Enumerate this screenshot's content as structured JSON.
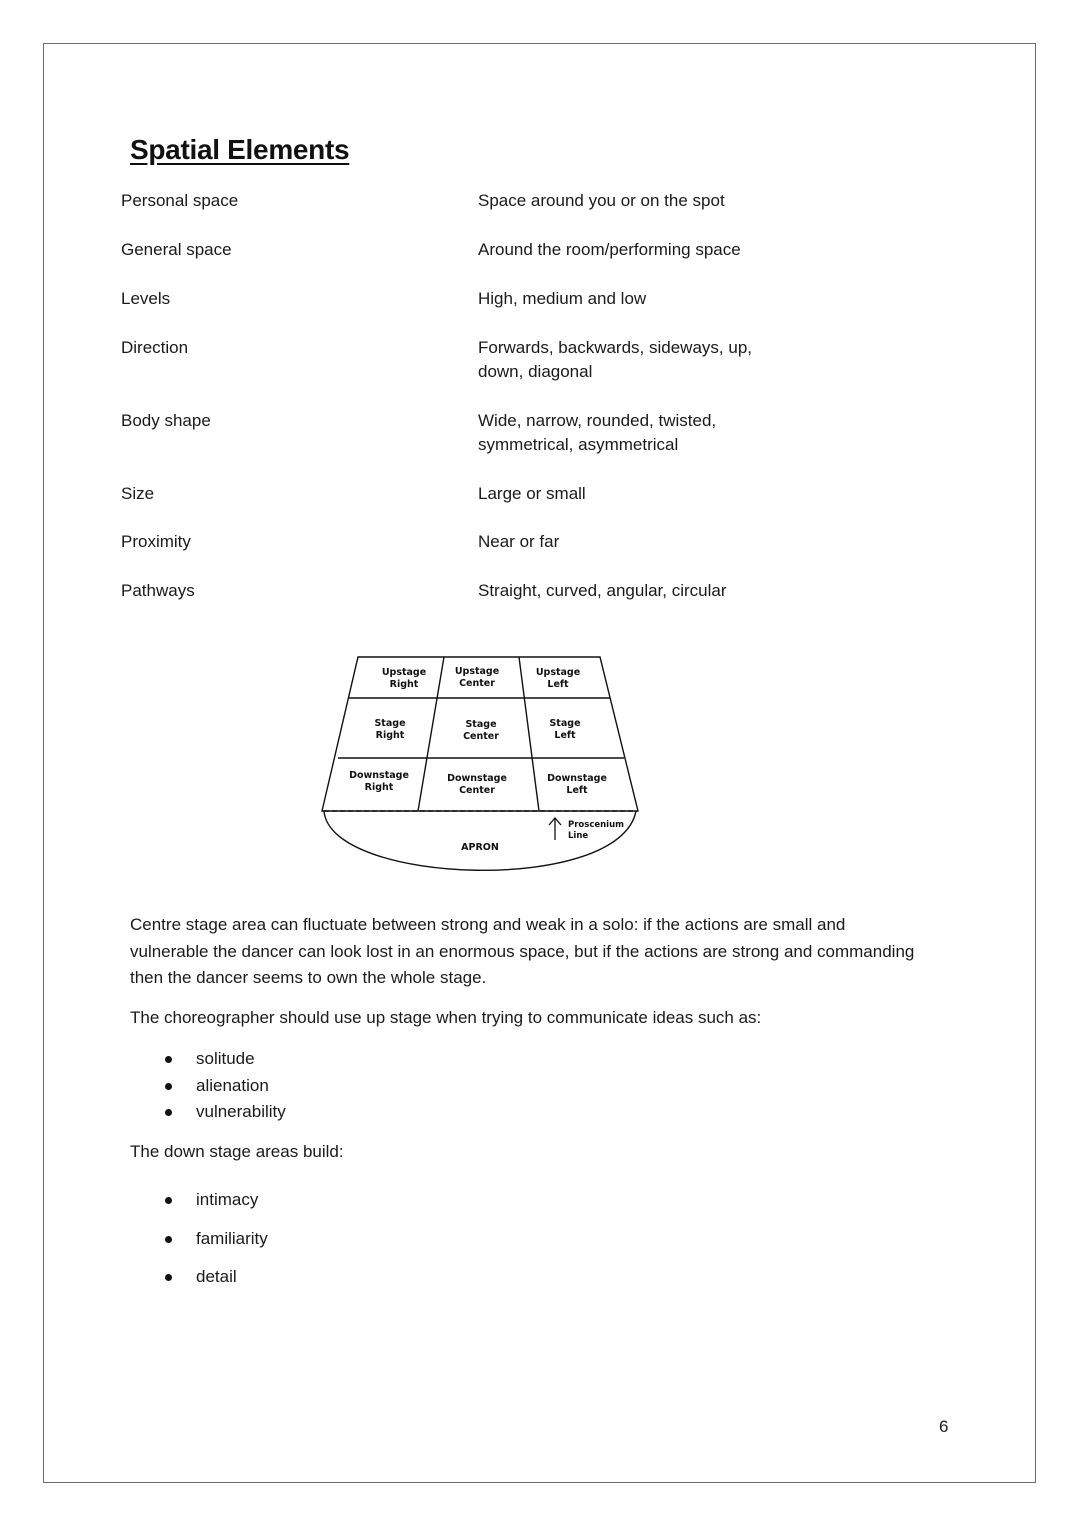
{
  "title": "Spatial Elements",
  "elements": [
    {
      "term": "Personal space",
      "definition": "Space around you or on the spot"
    },
    {
      "term": "General space",
      "definition": "Around the room/performing space"
    },
    {
      "term": "Levels",
      "definition": "High, medium and low"
    },
    {
      "term": "Direction",
      "definition": "Forwards, backwards, sideways, up, down, diagonal"
    },
    {
      "term": "Body shape",
      "definition": "Wide, narrow, rounded, twisted, symmetrical, asymmetrical"
    },
    {
      "term": "Size",
      "definition": "Large or small"
    },
    {
      "term": "Proximity",
      "definition": "Near or far"
    },
    {
      "term": "Pathways",
      "definition": "Straight, curved, angular, circular"
    }
  ],
  "stage_diagram": {
    "areas": [
      {
        "line1": "Upstage",
        "line2": "Right"
      },
      {
        "line1": "Upstage",
        "line2": "Center"
      },
      {
        "line1": "Upstage",
        "line2": "Left"
      },
      {
        "line1": "Stage",
        "line2": "Right"
      },
      {
        "line1": "Stage",
        "line2": "Center"
      },
      {
        "line1": "Stage",
        "line2": "Left"
      },
      {
        "line1": "Downstage",
        "line2": "Right"
      },
      {
        "line1": "Downstage",
        "line2": "Center"
      },
      {
        "line1": "Downstage",
        "line2": "Left"
      }
    ],
    "apron_label": "APRON",
    "proscenium_line1": "Proscenium",
    "proscenium_line2": "Line"
  },
  "paragraphs": {
    "centre_stage": "Centre stage area can fluctuate between strong and weak in a solo: if the actions are small and vulnerable the dancer can look lost in an enormous space, but if the actions are strong and commanding then the dancer seems to own the whole stage.",
    "up_stage_intro": "The choreographer should use up stage when trying to communicate ideas such as:",
    "down_stage_intro": "The down stage areas build:"
  },
  "up_stage_ideas": [
    "solitude",
    "alienation",
    "vulnerability"
  ],
  "down_stage_builds": [
    "intimacy",
    "familiarity",
    "detail"
  ],
  "page_number": "6"
}
